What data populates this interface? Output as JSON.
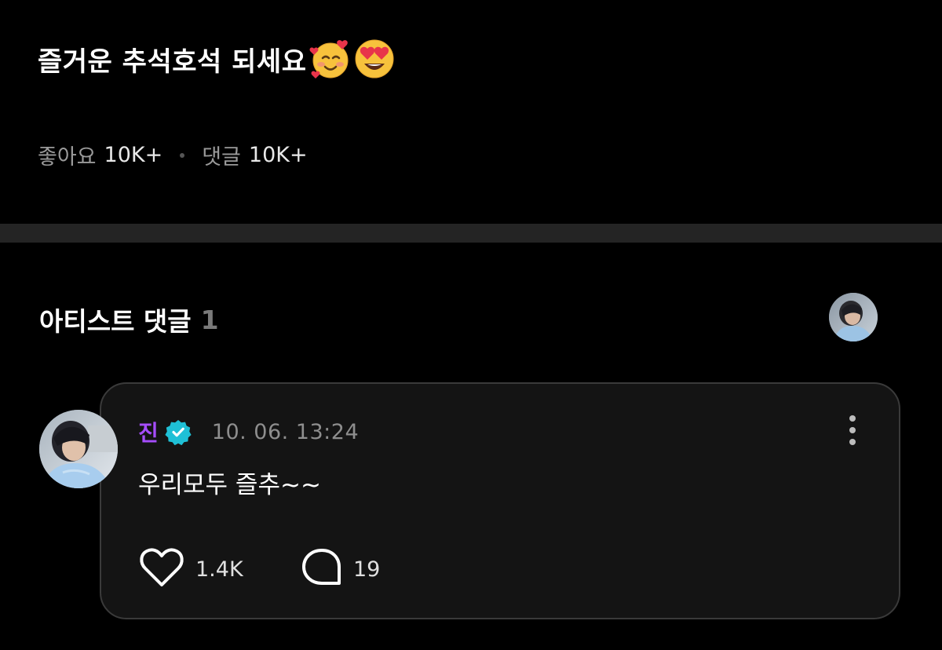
{
  "post": {
    "text": "즐거운 추석호석 되세요",
    "emojis": [
      "smiling-face-with-hearts-emoji",
      "heart-eyes-emoji"
    ]
  },
  "stats": {
    "likes_label": "좋아요",
    "likes_value": "10K+",
    "comments_label": "댓글",
    "comments_value": "10K+"
  },
  "artist_comments": {
    "title": "아티스트 댓글",
    "count": "1"
  },
  "comment": {
    "author": "진",
    "timestamp": "10. 06. 13:24",
    "body": "우리모두 즐추~~",
    "likes": "1.4K",
    "replies": "19"
  },
  "colors": {
    "background": "#000000",
    "card_background": "#141414",
    "card_border": "#3a3a3a",
    "author_name": "#a64dff",
    "verified_badge": "#1fc0d6",
    "muted_text": "#8e8e8e"
  },
  "icons": {
    "verified": "verified-badge-icon",
    "more": "more-vertical-icon",
    "like": "heart-outline-icon",
    "reply": "speech-bubble-icon"
  }
}
